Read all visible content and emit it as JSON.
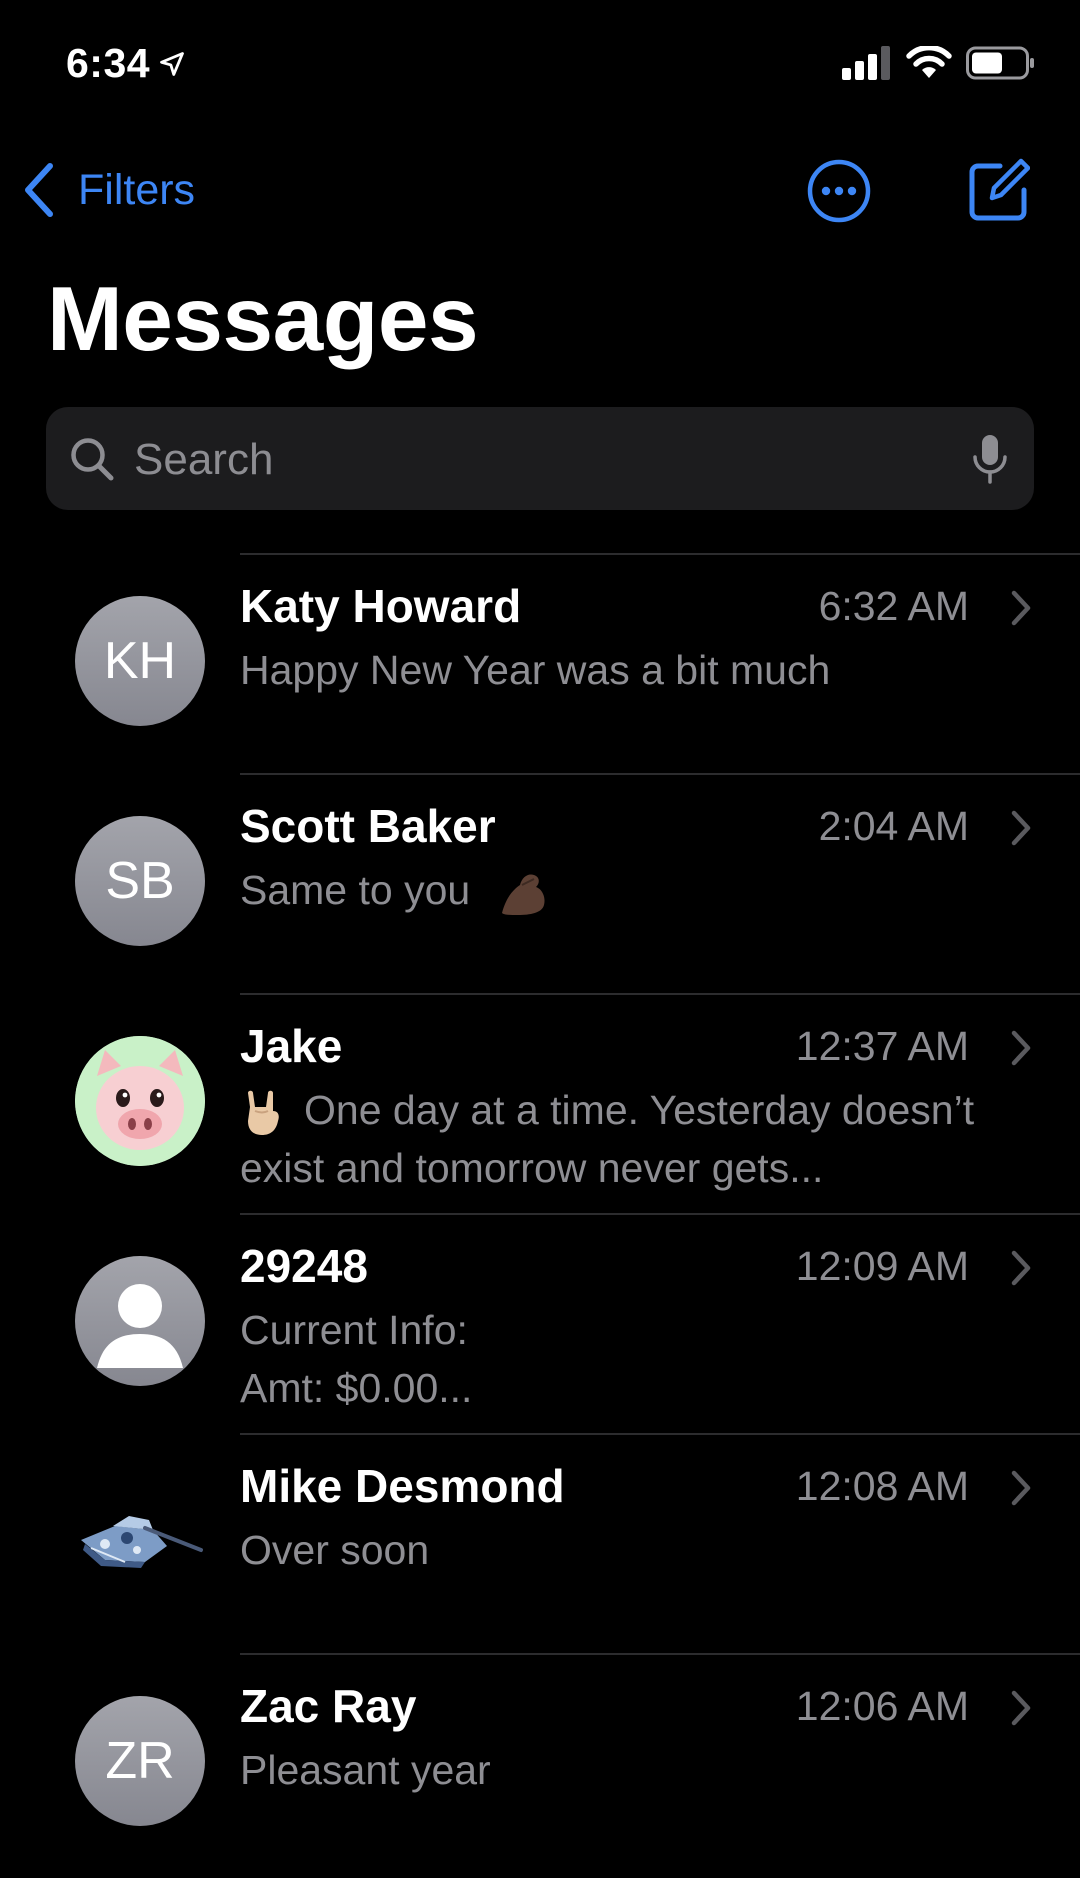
{
  "status_bar": {
    "time": "6:34"
  },
  "nav": {
    "back_label": "Filters"
  },
  "page_title": "Messages",
  "search": {
    "placeholder": "Search"
  },
  "conversations": [
    {
      "name": "Katy Howard",
      "initials": "KH",
      "time": "6:32 AM",
      "preview": "Happy New Year was a bit much",
      "avatar": "initials"
    },
    {
      "name": "Scott Baker",
      "initials": "SB",
      "time": "2:04 AM",
      "preview": "Same to you",
      "preview_emoji": "flexed-biceps",
      "avatar": "initials"
    },
    {
      "name": "Jake",
      "time": "12:37 AM",
      "preview_emoji": "rock-on-hand",
      "preview": "One day at a time. Yesterday doesn’t exist and tomorrow never gets...",
      "avatar": "pig-memoji"
    },
    {
      "name": "29248",
      "time": "12:09 AM",
      "preview_line1": "Current Info:",
      "preview_line2": "Amt: $0.00...",
      "avatar": "person-silhouette"
    },
    {
      "name": "Mike Desmond",
      "time": "12:08 AM",
      "preview": "Over soon",
      "avatar": "tank-photo"
    },
    {
      "name": "Zac Ray",
      "initials": "ZR",
      "time": "12:06 AM",
      "preview": "Pleasant year",
      "avatar": "initials"
    }
  ],
  "colors": {
    "accent": "#3d86f5",
    "background": "#000000",
    "search_bg": "#1c1c1e",
    "secondary_text": "#8e8e93",
    "avatar_gray": "#8e8f96"
  },
  "icons": {
    "location": "location-arrow-icon",
    "signal": "cellular-signal-icon",
    "wifi": "wifi-icon",
    "battery": "battery-icon",
    "back": "chevron-left-icon",
    "more": "ellipsis-circle-icon",
    "compose": "compose-icon",
    "search": "search-icon",
    "mic": "microphone-icon",
    "disclosure": "chevron-right-icon"
  }
}
